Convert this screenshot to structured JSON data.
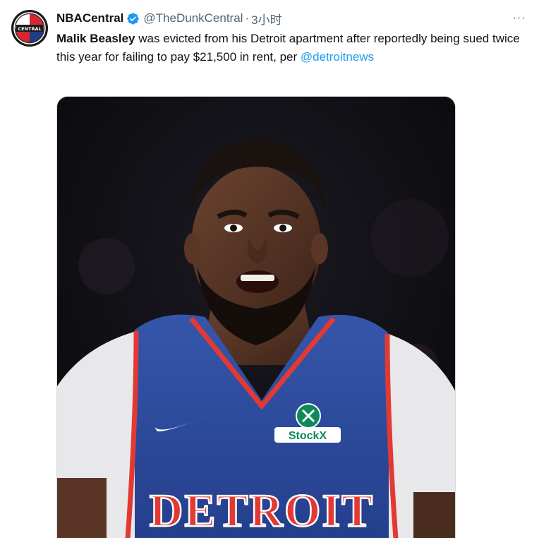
{
  "author": {
    "name": "NBACentral",
    "handle": "@TheDunkCentral",
    "separator": "·",
    "time": "3小时",
    "avatar_icon": "nba-central-logo-icon",
    "avatar_logo_text": "CENTRAL"
  },
  "menu": {
    "more_label": "···"
  },
  "tweet": {
    "bold_lead": "Malik Beasley",
    "body": " was evicted from his Detroit apartment after reportedly being sued twice this year for failing to pay $21,500 in rent, per ",
    "mention": "@detroitnews"
  },
  "media": {
    "jersey_text": "DETROIT",
    "sponsor_text": "StockX"
  },
  "colors": {
    "link": "#1d9bf0",
    "verified": "#1d9bf0",
    "jersey_blue": "#2c4a9a",
    "jersey_red": "#e23a33"
  }
}
